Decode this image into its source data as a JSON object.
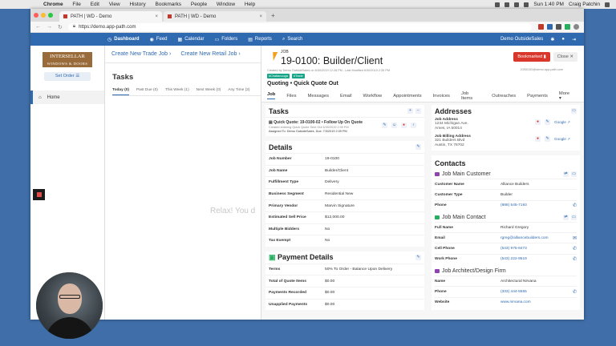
{
  "menubar": {
    "apple": "",
    "app": "Chrome",
    "items": [
      "File",
      "Edit",
      "View",
      "History",
      "Bookmarks",
      "People",
      "Window",
      "Help"
    ],
    "clock": "Sun 1:40 PM",
    "user": "Craig Patchin"
  },
  "browser": {
    "tabs": [
      {
        "title": "PATH | WD - Demo",
        "close": "×"
      },
      {
        "title": "PATH | WD - Demo",
        "close": "×"
      }
    ],
    "new_tab": "+",
    "url": "https://demo.app-path.com"
  },
  "topnav": {
    "items": [
      {
        "icon": "◷",
        "label": "Dashboard"
      },
      {
        "icon": "◉",
        "label": "Feed"
      },
      {
        "icon": "▦",
        "label": "Calendar"
      },
      {
        "icon": "▭",
        "label": "Folders"
      },
      {
        "icon": "▤",
        "label": "Reports"
      },
      {
        "icon": "⌕",
        "label": "Search"
      }
    ],
    "account": "Demo OutsideSales"
  },
  "sidebar": {
    "logo_main": "INTERSELLAR",
    "logo_sub": "WINDOWS & DOORS",
    "order_button": "Set Order",
    "home": "Home"
  },
  "left_panel": {
    "buttons": [
      "Create New Trade Job",
      "Create New Retail Job"
    ],
    "tasks_title": "Tasks",
    "filters": [
      "Today (0)",
      "Past Due (0)",
      "This Week (1)",
      "Next Week (0)",
      "Any Time (3)"
    ],
    "empty_text": "Relax! You do"
  },
  "job": {
    "number_label": "JOB",
    "title": "19-0100: Builder/Client",
    "created": "Created by Demo OutsideSales on 6/30/2019 12:28 PM - Last Modified 6/30/2019 2:39 PM",
    "tags": [
      "#Chattanooga",
      "#Trade"
    ],
    "subtitle": "Quoting • Quick Quote Out",
    "bookmarked": "Bookmarked",
    "close": "Close",
    "email": "JOB0100@demo.app-path.com",
    "tabs": [
      "Job",
      "Files",
      "Messages",
      "Email",
      "Workflow",
      "Appointments",
      "Invoices",
      "Job Items",
      "Outreaches",
      "Payments",
      "More"
    ]
  },
  "tasks_card": {
    "title": "Tasks",
    "item_title": "Quick Quote: 19-0100-02 • Follow Up On Quote",
    "item_meta": "Created entering Quick Quote Sent Out 6/30/2019 2:39 PM",
    "item_assigned": "Assigned To: Demo OutsideSales, Due: 7/3/2019 2:39 PM"
  },
  "details": {
    "title": "Details",
    "rows": [
      {
        "k": "Job Number",
        "v": "19-0100"
      },
      {
        "k": "Job Name",
        "v": "Builder/Client"
      },
      {
        "k": "Fulfillment Type",
        "v": "Delivery"
      },
      {
        "k": "Business Segment",
        "v": "Residential New"
      },
      {
        "k": "Primary Vendor",
        "v": "Marvin Signature"
      },
      {
        "k": "Estimated Sell Price",
        "v": "$12,000.00"
      },
      {
        "k": "Multiple Bidders",
        "v": "No"
      },
      {
        "k": "Tax Exempt",
        "v": "No"
      }
    ]
  },
  "payment": {
    "title": "Payment Details",
    "rows": [
      {
        "k": "Terms",
        "v": "50% To Order - Balance Upon Delivery"
      },
      {
        "k": "Total of Quote Items",
        "v": "$0.00"
      },
      {
        "k": "Payments Recorded",
        "v": "$0.00"
      },
      {
        "k": "Unapplied Payments",
        "v": "$0.00"
      }
    ]
  },
  "addresses": {
    "title": "Addresses",
    "items": [
      {
        "k": "Job Address",
        "lines": [
          "1234 Michigan Ave.",
          "Ames, IA 50014"
        ],
        "map": "Google"
      },
      {
        "k": "Job Billing Address",
        "lines": [
          "321 Builders Blvd",
          "Austin, TX 78702"
        ],
        "map": "Google"
      }
    ]
  },
  "contacts": {
    "title": "Contacts",
    "sections": [
      {
        "title": "Job Main Customer",
        "color": "#8e44ad",
        "rows": [
          {
            "k": "Customer Name",
            "v": "Alliance Builders",
            "link": false
          },
          {
            "k": "Customer Type",
            "v": "Builder",
            "link": false
          },
          {
            "k": "Phone",
            "v": "(888) 545-7193",
            "link": true,
            "act": "✆"
          }
        ]
      },
      {
        "title": "Job Main Contact",
        "color": "#27ae60",
        "rows": [
          {
            "k": "Full Name",
            "v": "Richard Gregory",
            "link": false
          },
          {
            "k": "Email",
            "v": "rgreg@alliancebuilders.com",
            "link": true,
            "act": "✉"
          },
          {
            "k": "Cell Phone",
            "v": "(543) 975-8473",
            "link": true,
            "act": "✆"
          },
          {
            "k": "Work Phone",
            "v": "(543) 222-9519",
            "link": true,
            "act": "✆"
          }
        ]
      },
      {
        "title": "Job Architect/Design Firm",
        "color": "#8e44ad",
        "rows": [
          {
            "k": "Name",
            "v": "Architectural Nirvana",
            "link": false
          },
          {
            "k": "Phone",
            "v": "(333) 444-5555",
            "link": true,
            "act": "✆"
          },
          {
            "k": "Website",
            "v": "www.nirvana.com",
            "link": true
          }
        ]
      }
    ]
  }
}
